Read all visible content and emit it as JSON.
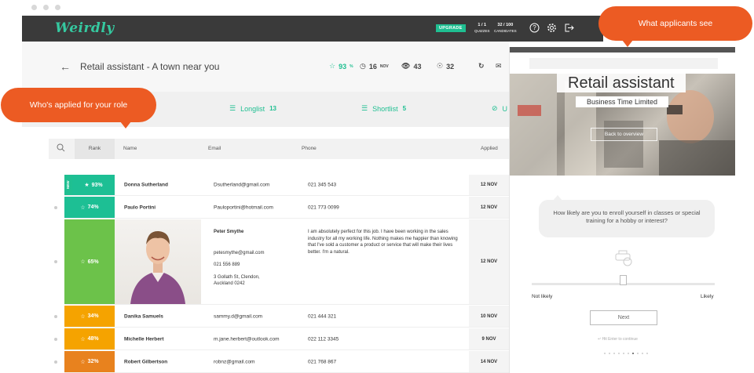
{
  "header": {
    "logo": "Weirdly",
    "upgrade_label": "UPGRADE",
    "quizzes_value": "1 / 1",
    "quizzes_label": "QUIZZES",
    "candidates_value": "32 / 100",
    "candidates_label": "CANDIDATES",
    "icons": [
      "help-icon",
      "gear-icon",
      "logout-icon"
    ]
  },
  "job": {
    "title": "Retail assistant - A town near you",
    "score": "93",
    "score_unit": "%",
    "date_day": "16",
    "date_month": "NOV",
    "views": "43",
    "applicants": "32"
  },
  "tabs": [
    {
      "label": "Longlist",
      "count": "13"
    },
    {
      "label": "Shortlist",
      "count": "5"
    },
    {
      "label": "U",
      "count": ""
    }
  ],
  "table": {
    "headers": {
      "rank": "Rank",
      "name": "Name",
      "email": "Email",
      "phone": "Phone",
      "applied": "Applied"
    },
    "new_tag": "NEW",
    "rows": [
      {
        "rank": "93%",
        "name": "Donna Sutherland",
        "email": "Dsutherland@gmail.com",
        "phone": "021 345 543",
        "applied": "12 NOV",
        "color": "#1dbf94"
      },
      {
        "rank": "74%",
        "name": "Paulo Portini",
        "email": "Pauloportini@hotmail.com",
        "phone": "021 773 0099",
        "applied": "12 NOV",
        "color": "#1dbf94"
      },
      {
        "rank": "65%",
        "name": "Peter Smythe",
        "email": "petesmythe@gmail.com",
        "phone": "021 556 889",
        "address_line1": "3 Gollath St, Clendon,",
        "address_line2": "Auckland 0242",
        "bio": "I am absolutely perfect for this job. I have been working in the sales industry for all my working life. Nothing makes me happier than knowing that I've sold a customer a product or service that will make their lives better. I'm a natural.",
        "applied": "12 NOV",
        "color": "#6cc24a"
      },
      {
        "rank": "34%",
        "name": "Danika Samuels",
        "email": "sammy.d@gmail.com",
        "phone": "021 444 321",
        "applied": "10 NOV",
        "color": "#f5a300"
      },
      {
        "rank": "48%",
        "name": "Michelle Herbert",
        "email": "m.jane.herbert@outlook.com",
        "phone": "022 112 3345",
        "applied": "9 NOV",
        "color": "#f5a300"
      },
      {
        "rank": "32%",
        "name": "Robert Gilbertson",
        "email": "robnz@gmail.com",
        "phone": "021 768 867",
        "applied": "14 NOV",
        "color": "#e8821e"
      }
    ]
  },
  "applicant_view": {
    "title": "Retail assistant",
    "company": "Business Time Limited",
    "back_button": "Back to overview",
    "question": "How likely are you to enroll yourself in classes or special training for a hobby or interest?",
    "scale_min": "Not likely",
    "scale_max": "Likely",
    "slider_value": 0.5,
    "next_button": "Next",
    "hint": "Hit Enter to continue"
  },
  "callouts": {
    "left": "Who's applied for your role",
    "right": "What applicants see"
  }
}
